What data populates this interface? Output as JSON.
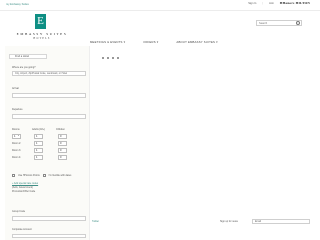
{
  "topbar": {
    "brand_link": "my Embassy Suites",
    "right_links": [
      "Sign In",
      "Join",
      "My Account"
    ],
    "hilton_logo": "HHonors\nHILTON"
  },
  "logo": {
    "letter": "E",
    "name": "EMBASSY SUITES",
    "sub": "HOTELS"
  },
  "search": {
    "placeholder": "Search"
  },
  "nav": {
    "items": [
      {
        "label": "MEETINGS & EVENTS",
        "chev": "▾"
      },
      {
        "label": "OFFERS",
        "chev": "▾"
      },
      {
        "label": "ABOUT EMBASSY SUITES",
        "chev": "▾"
      }
    ]
  },
  "sidebar": {
    "find_hotel_label": "Find a Hotel",
    "where_label": "Where are you going?",
    "where_value": "City, Airport, Zip/Postal Code, Landmark, or Hotel",
    "arrival_label": "Arrival",
    "departure_label": "Departure",
    "table": {
      "headers": [
        "Rooms",
        "Adults (18+)",
        "Children"
      ],
      "rows": [
        {
          "label": "Room 1:",
          "adults": "1",
          "children": "0"
        },
        {
          "label": "Room 2:",
          "adults": "1",
          "children": "0"
        },
        {
          "label": "Room 3:",
          "adults": "1",
          "children": "0"
        },
        {
          "label": "Room 4:",
          "adults": "1",
          "children": "0"
        }
      ]
    },
    "checkbox_1": "Use HHonors Points",
    "checkbox_2": "I'm flexible with dates",
    "special_rates_link": "+ Add special rate codes",
    "special_rates_sub": "(AAA, Government)",
    "promotion_label": "Promotion/Offer Code",
    "group_code_label": "Group Code",
    "corporate_label": "Corporate Account"
  },
  "footer": {
    "bottom_left": "Twitter",
    "bottom_mid": "Sign up for news",
    "bottom_field_placeholder": "Email"
  }
}
